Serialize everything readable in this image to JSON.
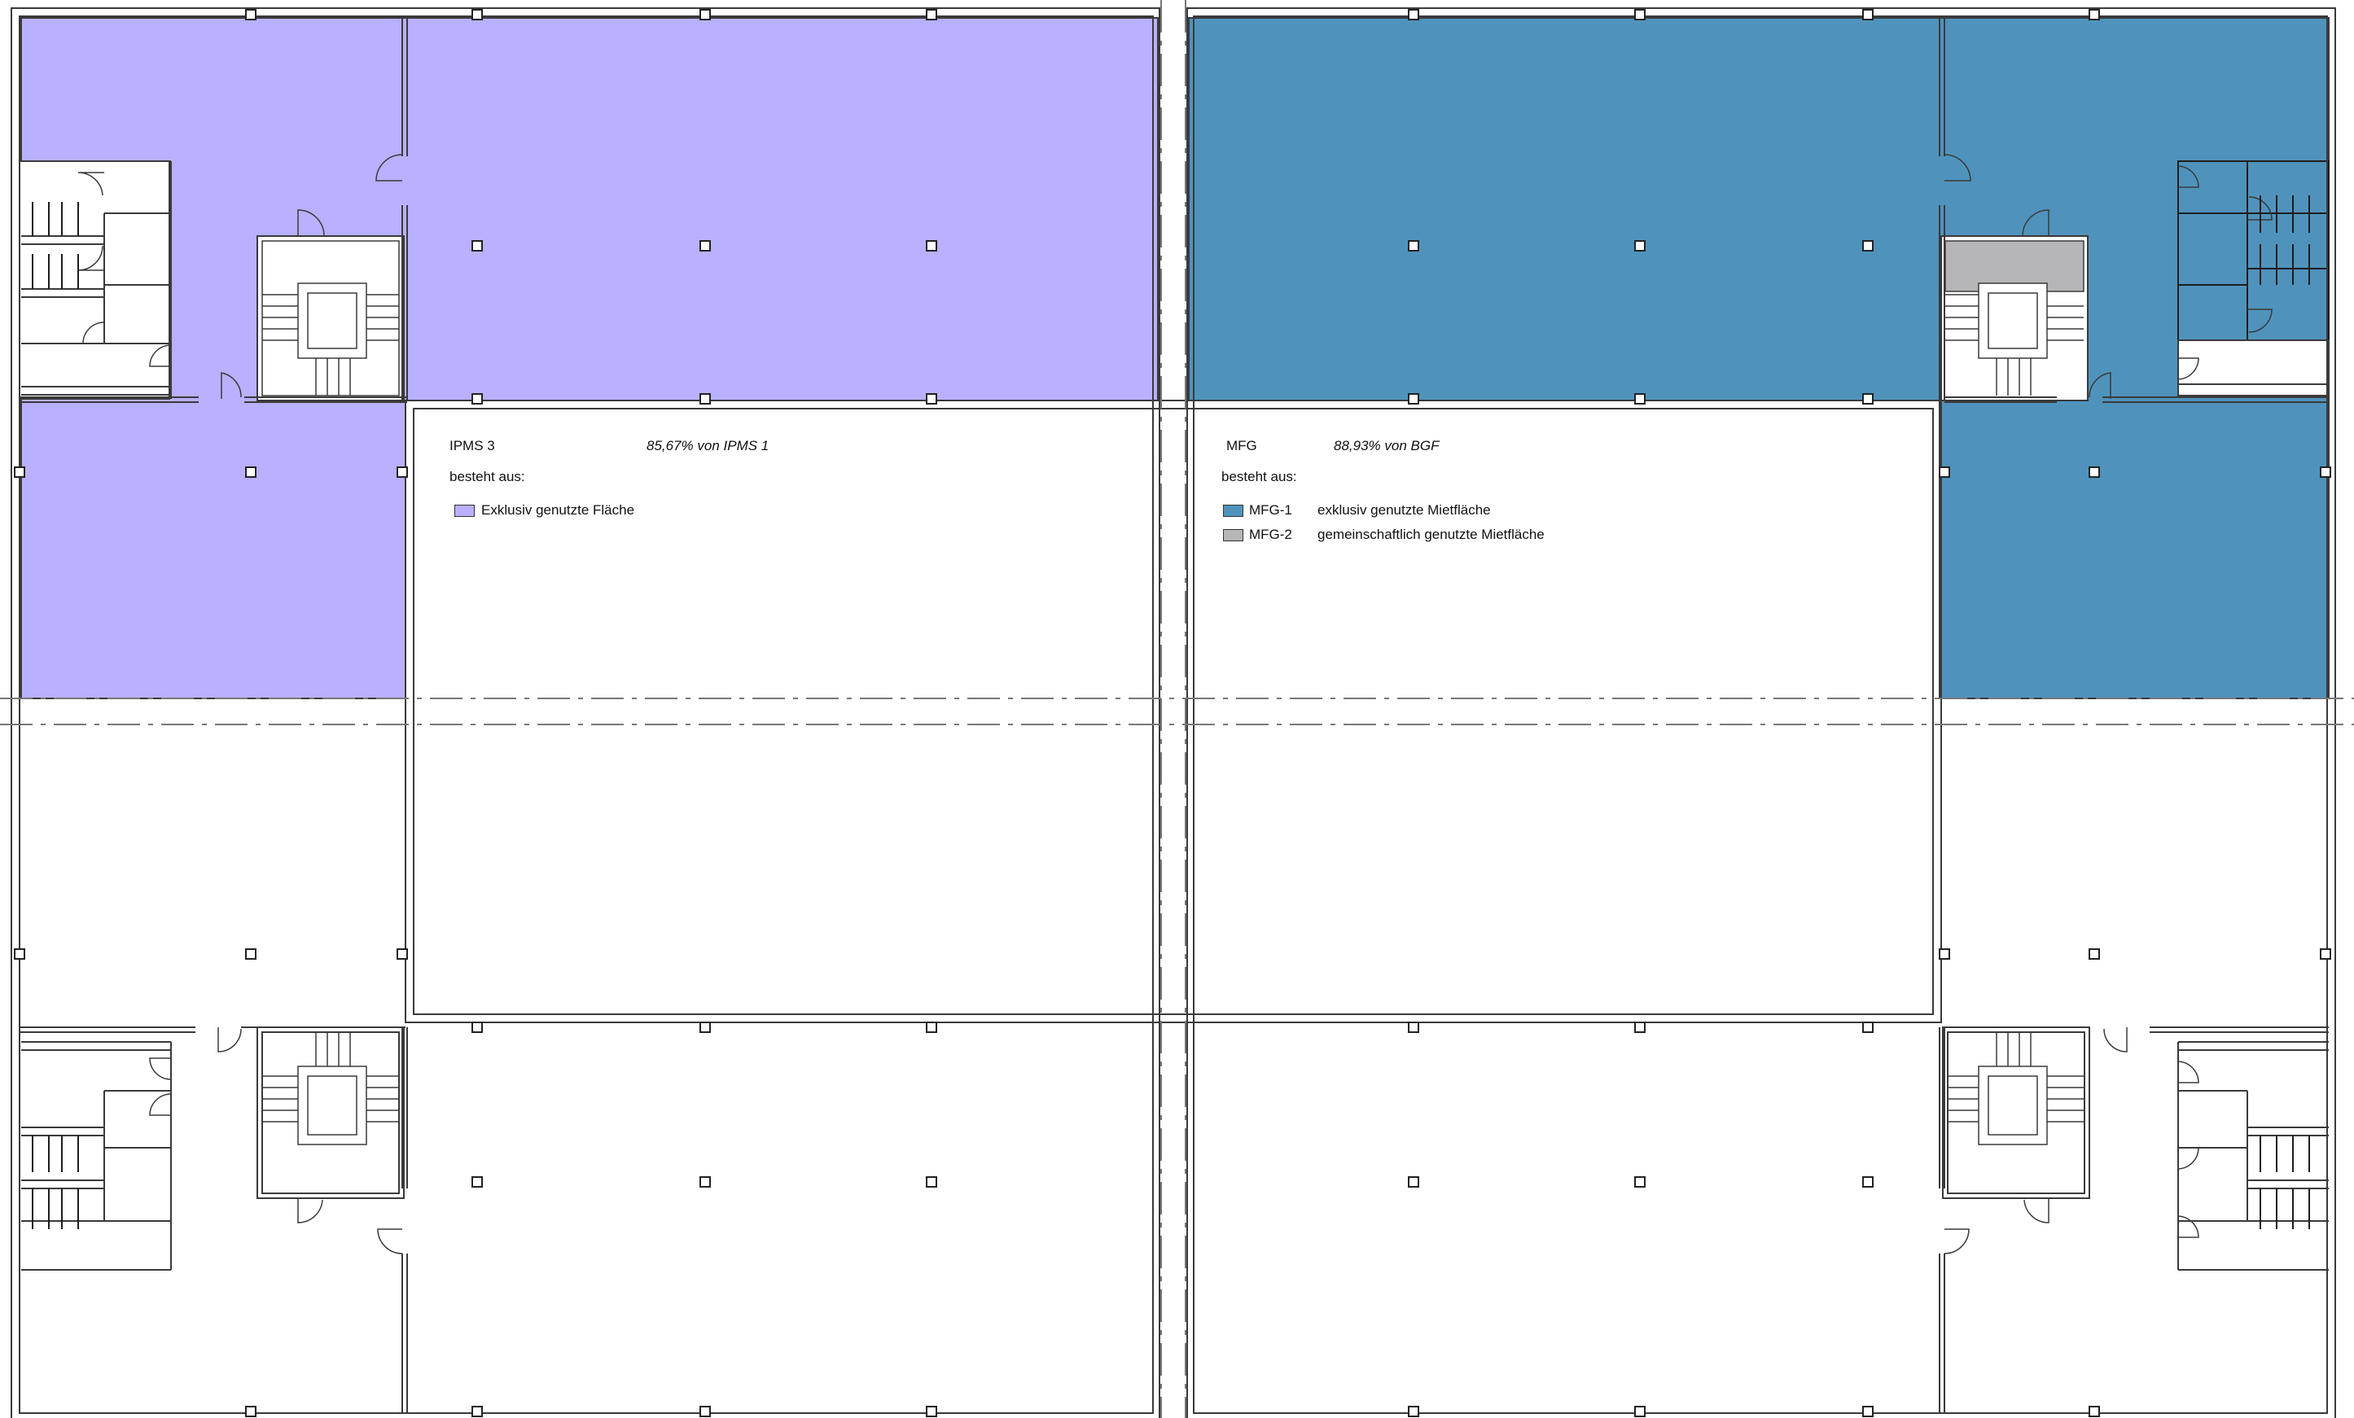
{
  "colors": {
    "ipms3": "#b9b0ff",
    "mfg1": "#4f93bc",
    "mfg2": "#b6b6b8",
    "wall": "#3a3a3a",
    "axis": "#777777"
  },
  "ipms_panel": {
    "title": "IPMS 3",
    "ratio": "85,67% von IPMS 1",
    "consists_of": "besteht aus:",
    "items": [
      {
        "label": "Exklusiv genutzte Fläche",
        "color": "#b9b0ff"
      }
    ]
  },
  "mfg_panel": {
    "title": "MFG",
    "ratio": "88,93% von BGF",
    "consists_of": "besteht aus:",
    "items": [
      {
        "code": "MFG-1",
        "label": "exklusiv genutzte Mietfläche",
        "color": "#4f93bc"
      },
      {
        "code": "MFG-2",
        "label": "gemeinschaftlich genutzte Mietfläche",
        "color": "#b6b6b8"
      }
    ]
  }
}
